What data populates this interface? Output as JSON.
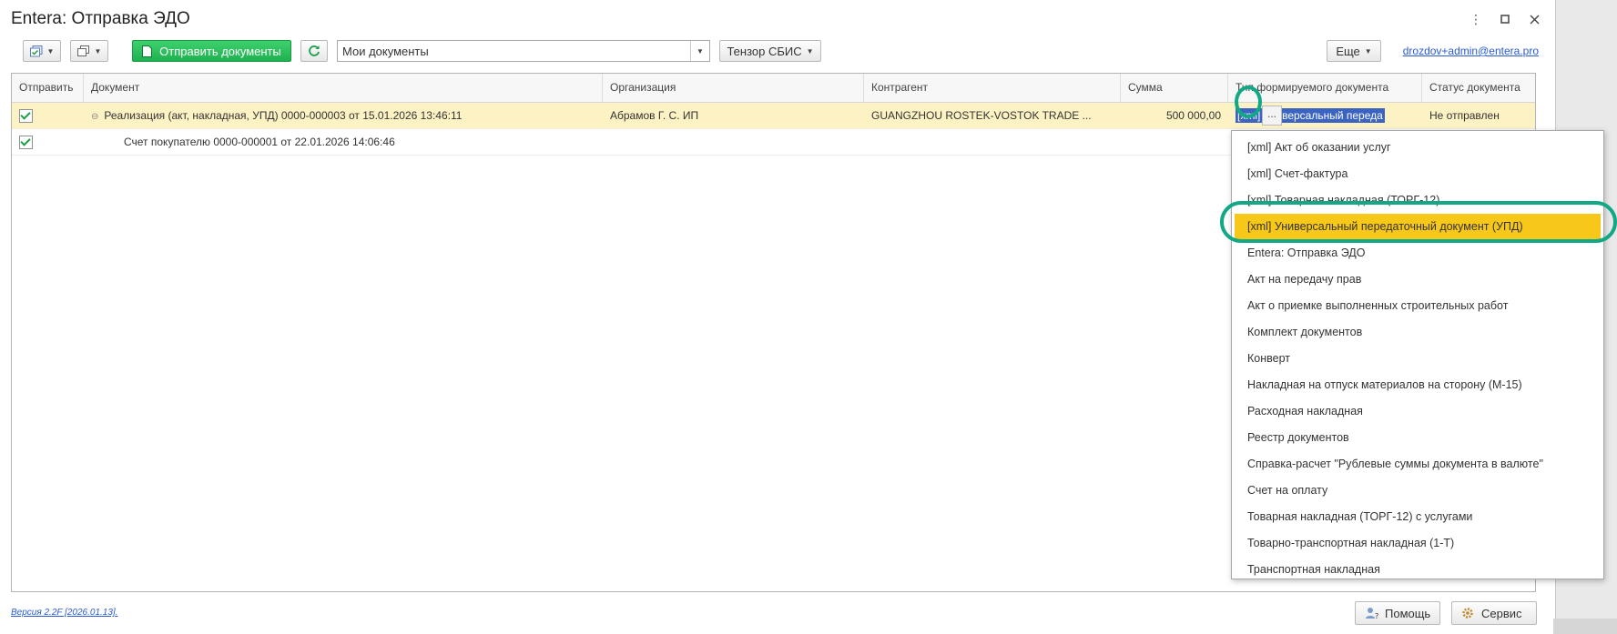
{
  "window": {
    "title": "Entera: Отправка ЭДО"
  },
  "toolbar": {
    "send_label": "Отправить документы",
    "filter_value": "Мои документы",
    "provider_label": "Тензор СБИС",
    "more_label": "Еще",
    "user_email": "drozdov+admin@entera.pro"
  },
  "grid": {
    "columns": [
      "Отправить",
      "Документ",
      "Организация",
      "Контрагент",
      "Сумма",
      "Тип формируемого документа",
      "Статус документа"
    ],
    "rows": [
      {
        "document": "Реализация (акт, накладная, УПД) 0000-000003 от 15.01.2026 13:46:11",
        "organization": "Абрамов Г. С. ИП",
        "counterparty": "GUANGZHOU ROSTEK-VOSTOK TRADE ...",
        "sum": "500 000,00",
        "doc_type": "[xml] Универсальный переда",
        "status": "Не отправлен"
      },
      {
        "document": "Счет покупателю 0000-000001 от 22.01.2026 14:06:46",
        "organization": "",
        "counterparty": "",
        "sum": "",
        "doc_type": "",
        "status": ""
      }
    ],
    "dots_label": "..."
  },
  "dropdown": {
    "items": [
      "[xml] Акт об оказании услуг",
      "[xml] Счет-фактура",
      "[xml] Товарная накладная (ТОРГ-12)",
      "[xml] Универсальный передаточный документ (УПД)",
      "Entera: Отправка ЭДО",
      "Акт на передачу прав",
      "Акт о приемке выполненных строительных работ",
      "Комплект документов",
      "Конверт",
      "Накладная на отпуск материалов на сторону (М-15)",
      "Расходная накладная",
      "Реестр документов",
      "Справка-расчет \"Рублевые суммы документа в валюте\"",
      "Счет на оплату",
      "Товарная накладная (ТОРГ-12) с услугами",
      "Товарно-транспортная накладная (1-Т)",
      "Транспортная накладная"
    ],
    "highlight_color": "#f7c81a"
  },
  "footer": {
    "version": "Версия 2.2F [2026.01.13].",
    "help_label": "Помощь",
    "service_label": "Сервис"
  },
  "colors": {
    "accent_green": "#1fb150",
    "annotation_ring": "#11a985",
    "selection_blue": "#3a63c2",
    "row_highlight": "#fdf2c4"
  }
}
